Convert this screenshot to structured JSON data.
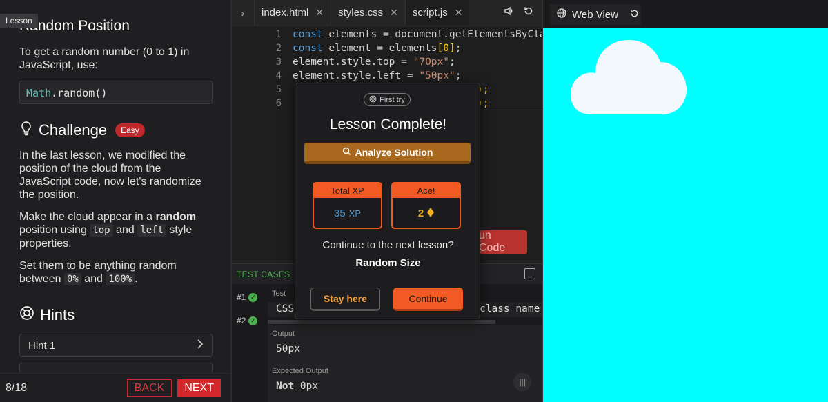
{
  "left": {
    "tag": "Lesson",
    "title": "Random Position",
    "intro": "To get a random number (0 to 1) in JavaScript, use:",
    "code_obj": "Math",
    "code_rest": ".random()",
    "challenge_title": "Challenge",
    "difficulty": "Easy",
    "para1": "In the last lesson, we modified the position of the cloud from the JavaScript code, now let's randomize the position.",
    "para2_a": "Make the cloud appear in a ",
    "para2_b": "random",
    "para2_c": " position using ",
    "para2_code1": "top",
    "para2_d": " and ",
    "para2_code2": "left",
    "para2_e": " style properties.",
    "para3_a": "Set them to be anything random between ",
    "para3_code1": "0%",
    "para3_b": " and ",
    "para3_code2": "100%",
    "para3_c": ".",
    "hints_title": "Hints",
    "hint1": "Hint 1",
    "progress": "8/18",
    "back": "BACK",
    "next": "NEXT"
  },
  "editor": {
    "tabs": [
      "index.html",
      "styles.css",
      "script.js"
    ],
    "active_tab": 2,
    "line_numbers": [
      "1",
      "2",
      "3",
      "4",
      "5",
      "6"
    ],
    "line1_kw": "const",
    "line1_rest": " elements = document.getElementsByClass",
    "line2_kw": "const",
    "line2_a": " element = elements",
    "line2_b": "[0]",
    "line2_c": ";",
    "line3_a": "element.style.top = ",
    "line3_s": "\"70px\"",
    "line3_c": ";",
    "line4_a": "element.style.left = ",
    "line4_s": "\"50px\"",
    "line4_c": ";",
    "line5_tail": ");",
    "line6_tail": ");",
    "run_fragment": "un Code"
  },
  "tests": {
    "label": "TEST CASES",
    "case1": "#1",
    "case2": "#2",
    "test_label": "Test",
    "test_val_left": "CSS",
    "test_val_right": "class name",
    "output_label": "Output",
    "output_val": "50px",
    "expected_label": "Expected Output",
    "expected_not": "Not",
    "expected_val": " 0px"
  },
  "modal": {
    "first_try": "First try",
    "title": "Lesson Complete!",
    "analyze": "Analyze Solution",
    "xp_label": "Total XP",
    "xp_value": "35",
    "xp_unit": "XP",
    "ace_label": "Ace!",
    "ace_value": "2",
    "question": "Continue to the next lesson?",
    "next_lesson": "Random Size",
    "stay": "Stay here",
    "continue": "Continue"
  },
  "webview": {
    "label": "Web View",
    "background": "#00ffff",
    "cloud_color": "#f2f8fc"
  }
}
